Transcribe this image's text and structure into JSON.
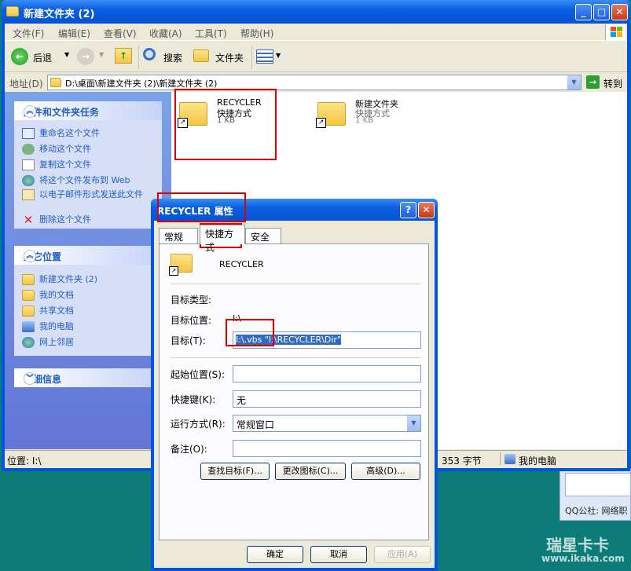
{
  "explorer": {
    "title": "新建文件夹 (2)",
    "menu": [
      "文件(F)",
      "编辑(E)",
      "查看(V)",
      "收藏(A)",
      "工具(T)",
      "帮助(H)"
    ],
    "toolbar": {
      "back": "后退",
      "search": "搜索",
      "folders": "文件夹"
    },
    "address_label": "地址(D)",
    "address_value": "D:\\桌面\\新建文件夹 (2)\\新建文件夹 (2)",
    "go_label": "转到",
    "tasks": {
      "title": "文件和文件夹任务",
      "items": [
        "重命名这个文件",
        "移动这个文件",
        "复制这个文件",
        "将这个文件发布到 Web",
        "以电子邮件形式发送此文件",
        "删除这个文件"
      ]
    },
    "places": {
      "title": "其它位置",
      "items": [
        "新建文件夹 (2)",
        "我的文档",
        "共享文档",
        "我的电脑",
        "网上邻居"
      ]
    },
    "details": {
      "title": "详细信息"
    },
    "files": [
      {
        "name": "RECYCLER",
        "type": "快捷方式",
        "size": "1 KB"
      },
      {
        "name": "新建文件夹",
        "type": "快捷方式",
        "size": "1 KB"
      }
    ],
    "status": {
      "location": "位置: I:\\",
      "size": "353 字节",
      "computer": "我的电脑"
    }
  },
  "dialog": {
    "title": "RECYCLER 属性",
    "tabs": [
      "常规",
      "快捷方式",
      "安全"
    ],
    "name": "RECYCLER",
    "target_type_label": "目标类型:",
    "target_location_label": "目标位置:",
    "target_location_value": "I:\\",
    "target_label": "目标(T):",
    "target_value": "I:\\.vbs \"I:\\RECYCLER\\Dir\"",
    "start_in_label": "起始位置(S):",
    "start_in_value": "",
    "hotkey_label": "快捷键(K):",
    "hotkey_value": "无",
    "run_label": "运行方式(R):",
    "run_value": "常规窗口",
    "comment_label": "备注(O):",
    "comment_value": "",
    "buttons": {
      "find": "查找目标(F)...",
      "change_icon": "更改图标(C)...",
      "advanced": "高级(D)...",
      "ok": "确定",
      "cancel": "取消",
      "apply": "应用(A)"
    }
  },
  "background": {
    "qq_text": "QQ公社: 网络职",
    "watermark": "瑞星卡卡",
    "watermark_url": "www.ikaka.com"
  },
  "colors": {
    "title_blue": "#0a5fe0",
    "link_blue": "#215dc6",
    "highlight": "#e00000",
    "selection": "#316ac5"
  }
}
